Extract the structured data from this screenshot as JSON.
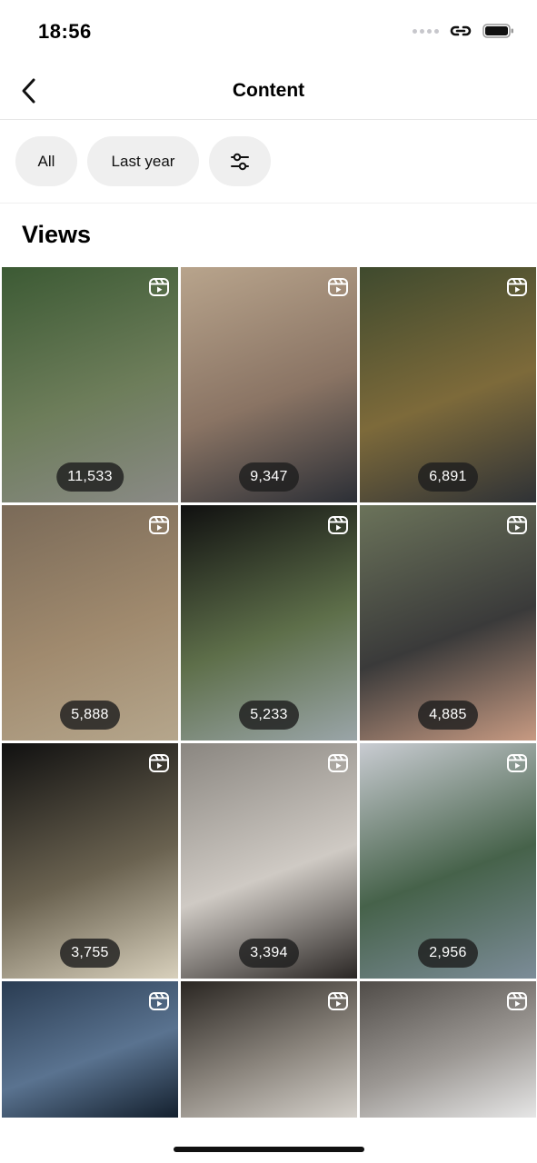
{
  "status": {
    "time": "18:56"
  },
  "nav": {
    "title": "Content"
  },
  "filters": {
    "all_label": "All",
    "period_label": "Last year"
  },
  "section": {
    "title": "Views"
  },
  "tiles": [
    {
      "views": "11,533",
      "scene": "forest-road",
      "colors": [
        "#3c5a34",
        "#6d7d5a",
        "#8a8a86"
      ]
    },
    {
      "views": "9,347",
      "scene": "officer-garage",
      "colors": [
        "#b8a48c",
        "#8a7464",
        "#2c2f36"
      ]
    },
    {
      "views": "6,891",
      "scene": "wolf-stream",
      "colors": [
        "#3f4a2e",
        "#7d6a3a",
        "#2f3236"
      ]
    },
    {
      "views": "5,888",
      "scene": "wolves-deck",
      "colors": [
        "#7a6a58",
        "#a08a6e",
        "#b5a68c"
      ]
    },
    {
      "views": "5,233",
      "scene": "wolf-fence",
      "colors": [
        "#101010",
        "#5e6f4a",
        "#9aa5a8"
      ]
    },
    {
      "views": "4,885",
      "scene": "wolf-selfie",
      "colors": [
        "#6b735a",
        "#3a3a3a",
        "#c79a82"
      ]
    },
    {
      "views": "3,755",
      "scene": "white-wolf-forest",
      "colors": [
        "#101010",
        "#6a6250",
        "#d8d0bc"
      ]
    },
    {
      "views": "3,394",
      "scene": "wolf-closeup",
      "colors": [
        "#8a8680",
        "#cfcac4",
        "#2a2624"
      ]
    },
    {
      "views": "2,956",
      "scene": "river-bear",
      "colors": [
        "#c9ccd2",
        "#46624a",
        "#7c8c98"
      ]
    },
    {
      "views": "",
      "scene": "wolf-snarl",
      "colors": [
        "#2a3c52",
        "#5a7390",
        "#14202e"
      ]
    },
    {
      "views": "",
      "scene": "white-wolves",
      "colors": [
        "#2a2622",
        "#8a847c",
        "#d4d0ca"
      ]
    },
    {
      "views": "",
      "scene": "wolf-snow",
      "colors": [
        "#504c48",
        "#9c9894",
        "#e6e6e6"
      ]
    }
  ]
}
